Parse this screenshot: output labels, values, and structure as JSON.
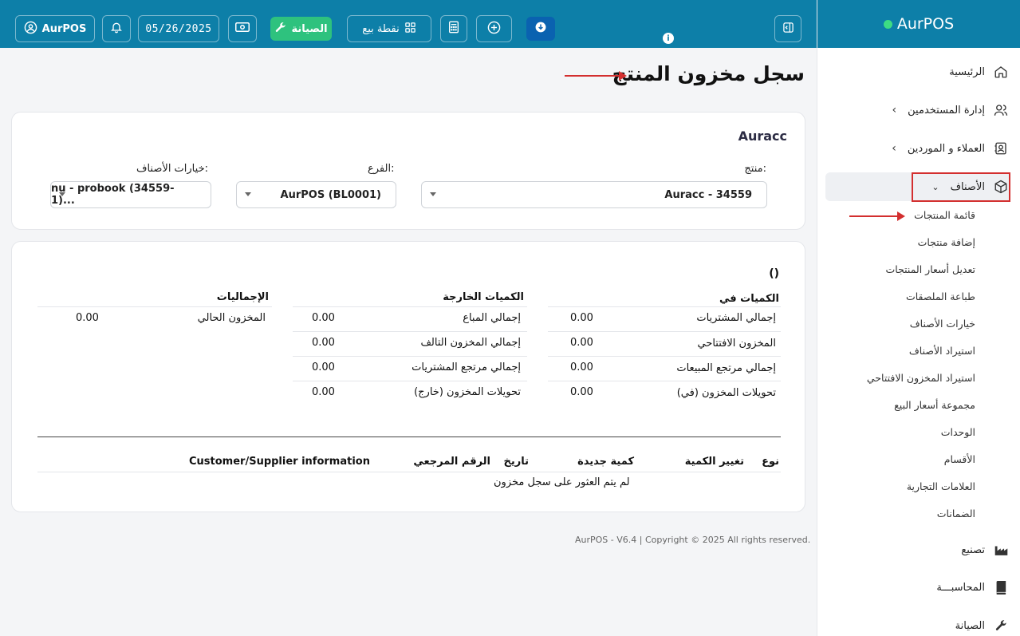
{
  "brand": {
    "name": "AurPOS",
    "dot_color": "#3ddc84"
  },
  "header": {
    "user_label": "AurPOS",
    "date": "05/26/2025",
    "maintenance_label": "الصيانة",
    "pos_label": "نقطة بيع"
  },
  "sidebar": {
    "items": [
      {
        "label": "الرئيسية",
        "icon": "home-icon"
      },
      {
        "label": "إدارة المستخدمين",
        "icon": "users-icon"
      },
      {
        "label": "العملاء و الموردين",
        "icon": "contacts-icon"
      },
      {
        "label": "الأصناف",
        "icon": "box-icon"
      },
      {
        "label": "تصنيع",
        "icon": "factory-icon"
      },
      {
        "label": "المحاسبـــة",
        "icon": "book-icon"
      },
      {
        "label": "الصيانة",
        "icon": "wrench-icon"
      }
    ],
    "subitems": [
      "قائمة المنتجات",
      "إضافة منتجات",
      "تعديل أسعار المنتجات",
      "طباعة الملصقات",
      "خيارات الأصناف",
      "استيراد الأصناف",
      "استيراد المخزون الافتتاحي",
      "مجموعة أسعار البيع",
      "الوحدات",
      "الأقسام",
      "العلامات التجارية",
      "الضمانات"
    ]
  },
  "page": {
    "title": "سجل مخزون المنتج"
  },
  "filters": {
    "card_title": "Auracc",
    "product_label": "منتج:",
    "product_value": "Auracc - 34559",
    "branch_label": "الفرع:",
    "branch_value": "AurPOS (BL0001)",
    "variation_label": "خيارات الأصناف:",
    "variation_value": "nu - probook (34559-1)..."
  },
  "summary": {
    "title": "()",
    "in_header": "الكميات في",
    "out_header": "الكميات الخارجة",
    "totals_header": "الإجماليات",
    "in_rows": [
      {
        "label": "إجمالي المشتريات",
        "value": "0.00"
      },
      {
        "label": "المخزون الافتتاحي",
        "value": "0.00"
      },
      {
        "label": "إجمالي مرتجع المبيعات",
        "value": "0.00"
      },
      {
        "label": "تحويلات المخزون (في)",
        "value": "0.00"
      }
    ],
    "out_rows": [
      {
        "label": "إجمالي المباع",
        "value": "0.00"
      },
      {
        "label": "إجمالي المخزون التالف",
        "value": "0.00"
      },
      {
        "label": "إجمالي مرتجع المشتريات",
        "value": "0.00"
      },
      {
        "label": "تحويلات المخزون (خارج)",
        "value": "0.00"
      }
    ],
    "totals_rows": [
      {
        "label": "المخزون الحالي",
        "value": "0.00"
      }
    ]
  },
  "history_table": {
    "columns": [
      "نوع",
      "تغيير الكمية",
      "كمية جديدة",
      "تاريخ",
      "الرقم المرجعي",
      "Customer/Supplier information"
    ],
    "empty_message": "لم يتم العثور على سجل مخزون"
  },
  "footer": {
    "text": "AurPOS - V6.4 | Copyright © 2025 All rights reserved."
  }
}
